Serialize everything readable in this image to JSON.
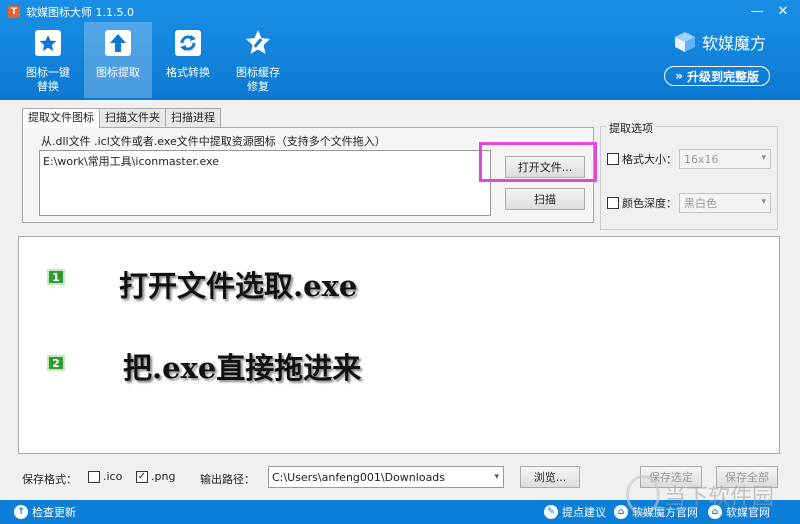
{
  "app": {
    "title": "软媒图标大师 1.1.5.0",
    "icon_letter": "T"
  },
  "window_controls": {
    "minimize": "—",
    "close": "✕"
  },
  "toolbar": [
    {
      "label": "图标一键\n替换",
      "icon": "star-icon"
    },
    {
      "label": "图标提取",
      "icon": "upload-arrow-icon"
    },
    {
      "label": "格式转换",
      "icon": "refresh-icon"
    },
    {
      "label": "图标缓存\n修复",
      "icon": "wrench-icon"
    }
  ],
  "brand": {
    "name": "软媒魔方",
    "upgrade": "升级到完整版",
    "upgrade_icon": "»"
  },
  "tabs": [
    "提取文件图标",
    "扫描文件夹",
    "扫描进程"
  ],
  "extract": {
    "hint": "从.dll文件 .icl文件或者.exe文件中提取资源图标（支持多个文件拖入）",
    "path": "E:\\work\\常用工具\\iconmaster.exe",
    "open_button": "打开文件...",
    "scan_button": "扫描"
  },
  "options": {
    "title": "提取选项",
    "size_label": "格式大小：",
    "size_value": "16x16",
    "depth_label": "颜色深度：",
    "depth_value": "黑白色"
  },
  "steps": [
    {
      "num": "1",
      "text": "打开文件选取.exe"
    },
    {
      "num": "2",
      "text": "把.exe直接拖进来"
    }
  ],
  "save": {
    "format_label": "保存格式：",
    "ico_label": ".ico",
    "png_label": ".png",
    "output_label": "输出路径：",
    "output_path": "C:\\Users\\anfeng001\\Downloads",
    "browse_button": "浏览...",
    "save_selected": "保存选定",
    "save_all": "保存全部"
  },
  "status": {
    "check_update": "检查更新",
    "suggest": "提点建议",
    "site1": "软媒魔方官网",
    "site2": "软媒官网"
  },
  "watermark": "当下软件园"
}
